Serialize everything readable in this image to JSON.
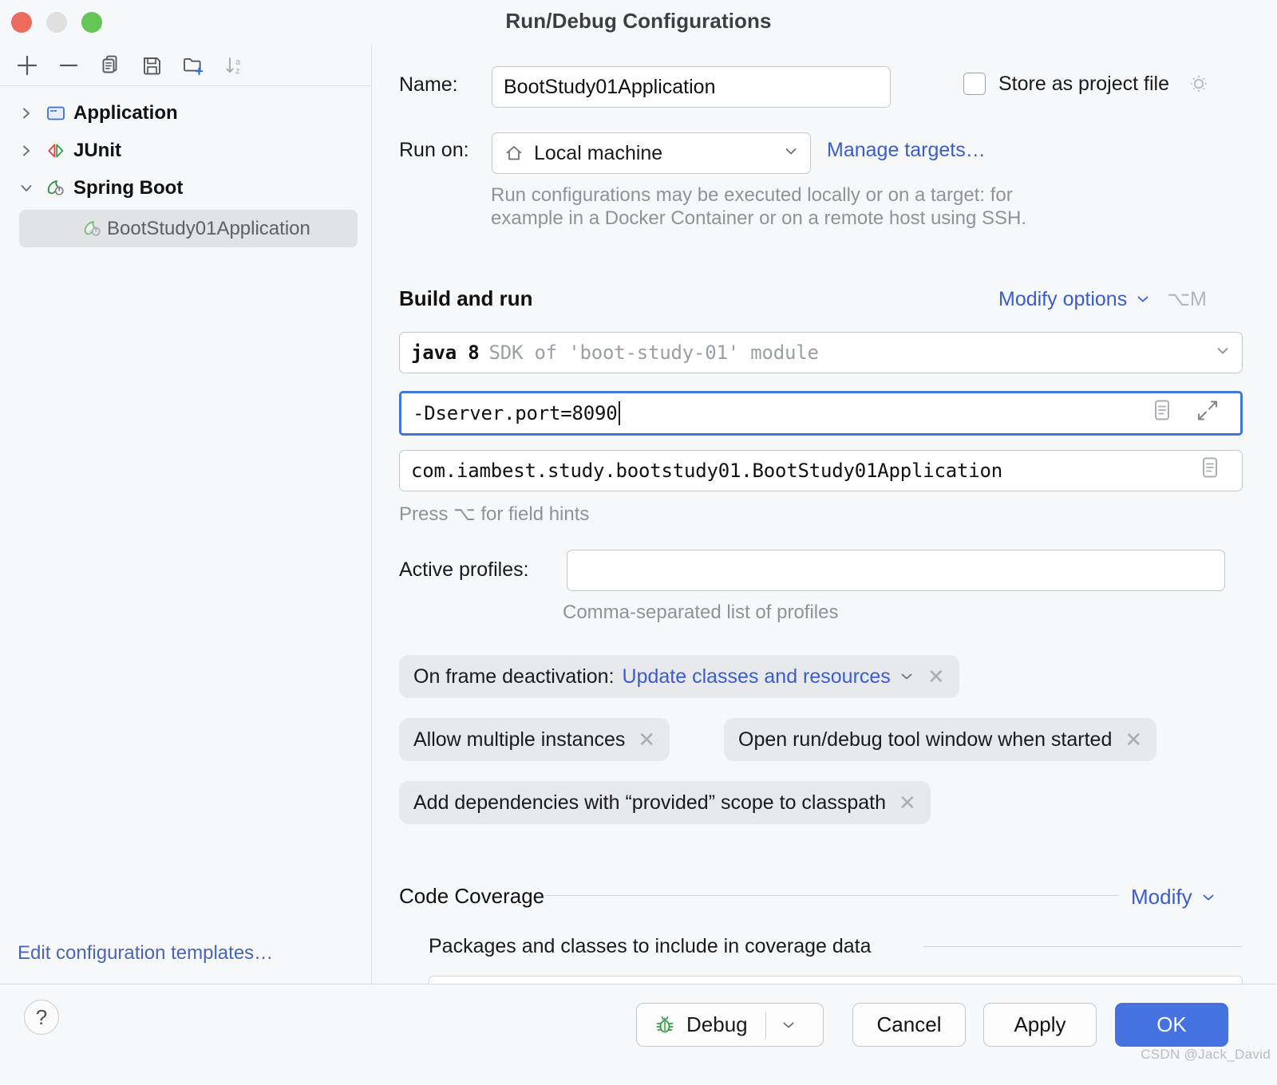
{
  "window": {
    "title": "Run/Debug Configurations"
  },
  "toolbar": {
    "items": [
      {
        "name": "add-icon",
        "tip": "Add New Configuration"
      },
      {
        "name": "remove-icon",
        "tip": "Remove Configuration"
      },
      {
        "name": "copy-icon",
        "tip": "Copy Configuration"
      },
      {
        "name": "save-icon",
        "tip": "Save Configuration"
      },
      {
        "name": "new-folder-icon",
        "tip": "Create New Folder"
      },
      {
        "name": "sort-alphabetically-icon",
        "tip": "Sort Configurations"
      }
    ]
  },
  "sidebar": {
    "items": [
      {
        "label": "Application",
        "icon": "application-icon",
        "expanded": false,
        "level": 0
      },
      {
        "label": "JUnit",
        "icon": "junit-icon",
        "expanded": false,
        "level": 0
      },
      {
        "label": "Spring Boot",
        "icon": "spring-boot-icon",
        "expanded": true,
        "level": 0
      },
      {
        "label": "BootStudy01Application",
        "icon": "spring-boot-icon",
        "selected": true,
        "level": 1
      }
    ],
    "edit_templates_link": "Edit configuration templates…"
  },
  "form": {
    "name_label": "Name:",
    "name_value": "BootStudy01Application",
    "store_as_project_file_label": "Store as project file",
    "store_as_project_file_checked": false,
    "run_on_label": "Run on:",
    "run_on_value": "Local machine",
    "manage_targets_link": "Manage targets…",
    "run_on_description_line1": "Run configurations may be executed locally or on a target: for",
    "run_on_description_line2": "example in a Docker Container or on a remote host using SSH.",
    "build_and_run_title": "Build and run",
    "modify_options_link": "Modify options",
    "modify_options_shortcut": "⌥M",
    "jre_value_bold": "java 8",
    "jre_value_dim": "SDK of 'boot-study-01' module",
    "vm_options_value": "-Dserver.port=8090",
    "main_class_value": "com.iambest.study.bootstudy01.BootStudy01Application",
    "field_hints_text": "Press ⌥ for field hints",
    "active_profiles_label": "Active profiles:",
    "active_profiles_value": "",
    "active_profiles_hint": "Comma-separated list of profiles",
    "chips": [
      {
        "label": "On frame deactivation:",
        "value": "Update classes and resources",
        "has_dropdown": true,
        "close": "✕"
      },
      {
        "label": "Allow multiple instances",
        "value": "",
        "has_dropdown": false,
        "close": "✕"
      },
      {
        "label": "Open run/debug tool window when started",
        "value": "",
        "has_dropdown": false,
        "close": "✕"
      },
      {
        "label": "Add dependencies with “provided” scope to classpath",
        "value": "",
        "has_dropdown": false,
        "close": "✕"
      }
    ],
    "code_coverage_title": "Code Coverage",
    "code_coverage_modify_link": "Modify",
    "coverage_packages_title": "Packages and classes to include in coverage data"
  },
  "footer": {
    "help_label": "?",
    "debug_label": "Debug",
    "cancel_label": "Cancel",
    "apply_label": "Apply",
    "ok_label": "OK"
  },
  "watermark": "CSDN @Jack_David",
  "colors": {
    "accent_blue": "#4572e0",
    "link_blue": "#3a5ccc",
    "focus_blue": "#4075d9",
    "chip_bg": "#e8e9ec",
    "panel_bg": "#f7f8fa",
    "traffic_red": "#ec6a5e",
    "traffic_yellow": "#e0e0e0",
    "traffic_green": "#62c554"
  }
}
